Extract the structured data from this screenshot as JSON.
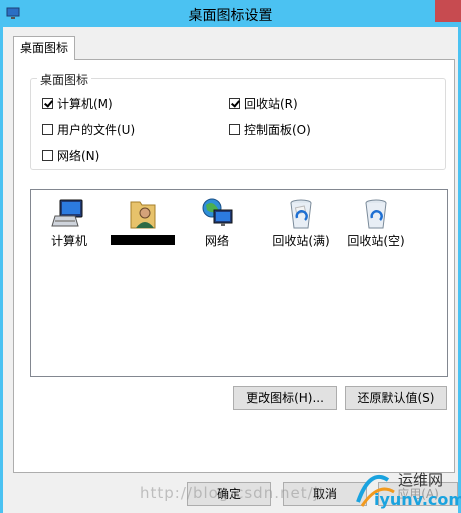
{
  "window": {
    "title": "桌面图标设置"
  },
  "tabs": [
    {
      "label": "桌面图标"
    }
  ],
  "group": {
    "legend": "桌面图标",
    "checkboxes": [
      {
        "label": "计算机(M)",
        "checked": true
      },
      {
        "label": "回收站(R)",
        "checked": true
      },
      {
        "label": "用户的文件(U)",
        "checked": false
      },
      {
        "label": "控制面板(O)",
        "checked": false
      },
      {
        "label": "网络(N)",
        "checked": false
      }
    ]
  },
  "icons": [
    {
      "label": "计算机",
      "icon": "computer-icon"
    },
    {
      "label": "",
      "icon": "user-folder-icon"
    },
    {
      "label": "网络",
      "icon": "network-icon"
    },
    {
      "label": "回收站(满)",
      "icon": "recycle-bin-full-icon"
    },
    {
      "label": "回收站(空)",
      "icon": "recycle-bin-empty-icon"
    }
  ],
  "buttons": {
    "change_icon": "更改图标(H)...",
    "restore_default": "还原默认值(S)",
    "ok": "确定",
    "cancel": "取消",
    "apply": "应用(A)"
  },
  "watermark": "http://blog.csdn.net/jt",
  "logo": {
    "name": "运维网",
    "site": "iyunv.com"
  }
}
